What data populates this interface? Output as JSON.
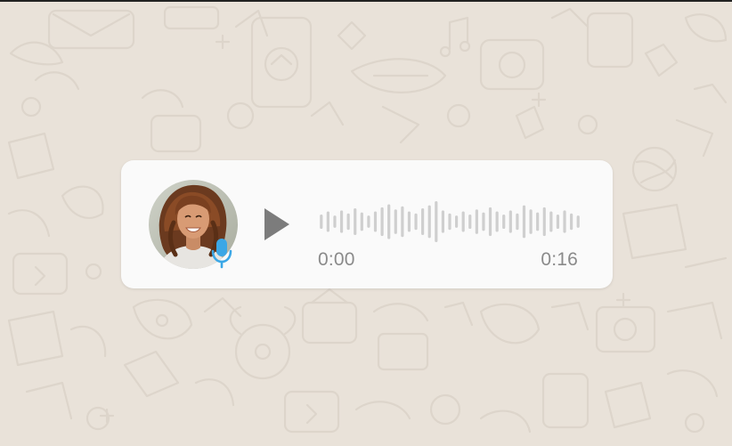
{
  "voice_message": {
    "current_time": "0:00",
    "duration": "0:16",
    "progress": 0,
    "waveform_levels": [
      0.35,
      0.5,
      0.3,
      0.55,
      0.4,
      0.65,
      0.45,
      0.3,
      0.5,
      0.7,
      0.85,
      0.6,
      0.75,
      0.5,
      0.4,
      0.65,
      0.8,
      1.0,
      0.55,
      0.4,
      0.3,
      0.5,
      0.35,
      0.6,
      0.45,
      0.7,
      0.5,
      0.35,
      0.55,
      0.4,
      0.8,
      0.6,
      0.45,
      0.7,
      0.5,
      0.35,
      0.55,
      0.4,
      0.3
    ],
    "accent_color": "#3ba7e6",
    "play_icon": "play-icon",
    "badge_icon": "microphone-icon"
  },
  "theme": {
    "background": "#e9e2d9",
    "card": "#fafafa",
    "waveform_color": "#cfcfcf",
    "text_color": "#8a8a8a"
  }
}
